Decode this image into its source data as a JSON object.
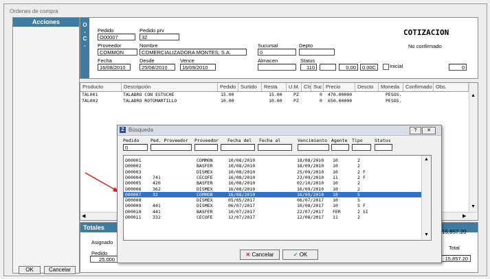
{
  "window": {
    "title": "Ordenes de compra"
  },
  "sidebar": {
    "title": "Acciones",
    "ok_label": "OK",
    "cancel_label": "Cancelar"
  },
  "header": {
    "oc_label": "O\n-\nC\n-",
    "doc_type": "COTIZACION",
    "doc_status": "No confirmado",
    "pedido_label": "Pedido",
    "pedido": "O00007",
    "pedido_prv_label": "Pedido prv",
    "pedido_prv": "32",
    "proveedor_label": "Proveedor",
    "proveedor": "COMMON",
    "nombre_label": "Nombre",
    "nombre": "COMERCIALIZADORA MONTES, S.A.",
    "sucursal_label": "Sucursal",
    "sucursal": "0",
    "depto_label": "Depto",
    "depto": "",
    "fecha_label": "Fecha",
    "fecha": "16/08/2010",
    "desde_label": "Desde",
    "desde": "25/08/2010",
    "vence_label": "Vence",
    "vence": "16/09/2010",
    "almacen_label": "Almacen",
    "almacen": "",
    "status_label": "Status",
    "status": "110",
    "v1": "0.00",
    "v2": "0.00C",
    "inicial_label": "Inicial",
    "right_value": "0"
  },
  "grid": {
    "columns": [
      "Producto",
      "Descripción",
      "Pedido",
      "Surtido",
      "Resta",
      "U.M.",
      "Cls",
      "Suc",
      "Precio",
      "Descto",
      "Moneda",
      "Confirmado",
      "Obs."
    ],
    "rows": [
      {
        "producto": "TAL001",
        "descripcion": "TALADRO CON ESTUCHE",
        "pedido": "15.00",
        "resta": "15.00",
        "um": "PZ",
        "suc": "0",
        "precio": "470.00000",
        "moneda": "PESOS."
      },
      {
        "producto": "TAL002",
        "descripcion": "TALADRO ROTOMARTILLO",
        "pedido": "10.00",
        "resta": "10.00",
        "um": "PZ",
        "suc": "0",
        "precio": "650.00000",
        "moneda": "PESOS."
      }
    ]
  },
  "totals": {
    "title": "Totales",
    "asignado_label": "Asignado",
    "pedido_label": "Pedido",
    "pedido_value": "25.000",
    "total_top": "15,857.20",
    "total_label": "Total",
    "total_value": "15,857.20"
  },
  "dialog": {
    "title": "Búsqueda",
    "help": "?",
    "filters": {
      "pedido_label": "Pedido",
      "pedido_value": "0",
      "ped_prov_label": "Ped. Proveedor",
      "proveedor_label": "Proveedor",
      "fecha_del_label": "Fecha del",
      "fecha_al_label": "Fecha al",
      "vencimiento_label": "Vencimiento",
      "agente_label": "Agente",
      "tipo_label": "Tipo",
      "status_label": "Status"
    },
    "rows": [
      {
        "pedido": "O00001",
        "ped_prov": "",
        "proveedor": "COMMON",
        "fecha": "10/08/2010",
        "vencimiento": "18/08/2010",
        "agente": "10",
        "tipo": "2",
        "status": ""
      },
      {
        "pedido": "O00002",
        "ped_prov": "",
        "proveedor": "BASFER",
        "fecha": "10/08/2010",
        "vencimiento": "18/09/2010",
        "agente": "10",
        "tipo": "2",
        "status": ""
      },
      {
        "pedido": "O00003",
        "ped_prov": "",
        "proveedor": "DISMEX",
        "fecha": "10/08/2010",
        "vencimiento": "25/09/2010",
        "agente": "10",
        "tipo": "2",
        "status": "F"
      },
      {
        "pedido": "O00004",
        "ped_prov": "741",
        "proveedor": "CECOFE",
        "fecha": "16/08/2010",
        "vencimiento": "23/09/2010",
        "agente": "11",
        "tipo": "2",
        "status": "F"
      },
      {
        "pedido": "O00005",
        "ped_prov": "420",
        "proveedor": "BASFER",
        "fecha": "16/08/2010",
        "vencimiento": "02/10/2010",
        "agente": "10",
        "tipo": "2",
        "status": ""
      },
      {
        "pedido": "O00006",
        "ped_prov": "362",
        "proveedor": "DISMEX",
        "fecha": "16/08/2010",
        "vencimiento": "16/09/2010",
        "agente": "10",
        "tipo": "2",
        "status": ""
      },
      {
        "pedido": "O00007",
        "ped_prov": "32",
        "proveedor": "COMMON",
        "fecha": "16/08/2010",
        "vencimiento": "16/09/2010",
        "agente": "10",
        "tipo": "5",
        "status": ""
      },
      {
        "pedido": "O00008",
        "ped_prov": "",
        "proveedor": "DISMEX",
        "fecha": "05/05/2017",
        "vencimiento": "06/07/2017",
        "agente": "10",
        "tipo": "5",
        "status": ""
      },
      {
        "pedido": "O00009",
        "ped_prov": "441",
        "proveedor": "DISMEX",
        "fecha": "06/07/2017",
        "vencimiento": "10/08/2017",
        "agente": "10",
        "tipo": "5",
        "status": "F"
      },
      {
        "pedido": "O00010",
        "ped_prov": "441",
        "proveedor": "BASFER",
        "fecha": "10/07/2017",
        "vencimiento": "22/07/2017",
        "agente": "FER",
        "tipo": "2",
        "status": "SI"
      },
      {
        "pedido": "O00011",
        "ped_prov": "332",
        "proveedor": "CECOFE",
        "fecha": "12/07/2017",
        "vencimiento": "12/08/2017",
        "agente": "11",
        "tipo": "2",
        "status": ""
      }
    ],
    "selected_index": 6,
    "cancel_label": "Cancelar",
    "ok_label": "OK"
  },
  "colors": {
    "accent": "#3f7da0",
    "selection": "#3172c7",
    "arrow": "#e02020",
    "ok_check": "#2a9a2a",
    "cancel_x": "#d02020"
  }
}
